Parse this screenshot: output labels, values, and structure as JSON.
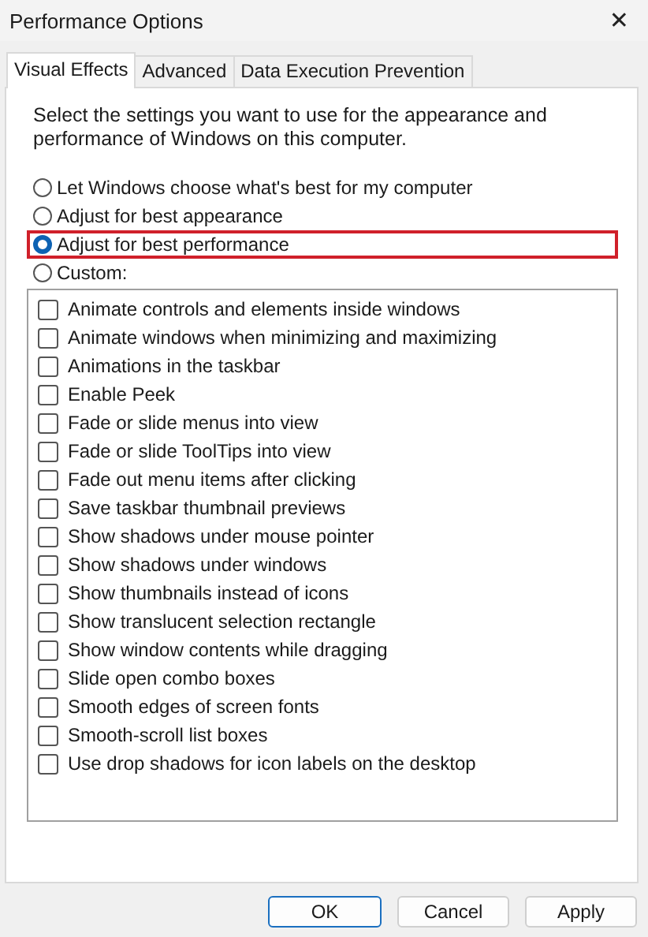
{
  "window": {
    "title": "Performance Options",
    "close_glyph": "✕"
  },
  "tabs": [
    {
      "label": "Visual Effects",
      "selected": true
    },
    {
      "label": "Advanced",
      "selected": false
    },
    {
      "label": "Data Execution Prevention",
      "selected": false
    }
  ],
  "description": "Select the settings you want to use for the appearance and performance of Windows on this computer.",
  "options": [
    {
      "label": "Let Windows choose what's best for my computer",
      "selected": false,
      "highlighted": false
    },
    {
      "label": "Adjust for best appearance",
      "selected": false,
      "highlighted": false
    },
    {
      "label": "Adjust for best performance",
      "selected": true,
      "highlighted": true
    },
    {
      "label": "Custom:",
      "selected": false,
      "highlighted": false
    }
  ],
  "effects": [
    {
      "label": "Animate controls and elements inside windows",
      "checked": false
    },
    {
      "label": "Animate windows when minimizing and maximizing",
      "checked": false
    },
    {
      "label": "Animations in the taskbar",
      "checked": false
    },
    {
      "label": "Enable Peek",
      "checked": false
    },
    {
      "label": "Fade or slide menus into view",
      "checked": false
    },
    {
      "label": "Fade or slide ToolTips into view",
      "checked": false
    },
    {
      "label": "Fade out menu items after clicking",
      "checked": false
    },
    {
      "label": "Save taskbar thumbnail previews",
      "checked": false
    },
    {
      "label": "Show shadows under mouse pointer",
      "checked": false
    },
    {
      "label": "Show shadows under windows",
      "checked": false
    },
    {
      "label": "Show thumbnails instead of icons",
      "checked": false
    },
    {
      "label": "Show translucent selection rectangle",
      "checked": false
    },
    {
      "label": "Show window contents while dragging",
      "checked": false
    },
    {
      "label": "Slide open combo boxes",
      "checked": false
    },
    {
      "label": "Smooth edges of screen fonts",
      "checked": false
    },
    {
      "label": "Smooth-scroll list boxes",
      "checked": false
    },
    {
      "label": "Use drop shadows for icon labels on the desktop",
      "checked": false
    }
  ],
  "buttons": [
    {
      "label": "OK",
      "kind": "default"
    },
    {
      "label": "Cancel",
      "kind": "normal"
    },
    {
      "label": "Apply",
      "kind": "normal"
    }
  ]
}
